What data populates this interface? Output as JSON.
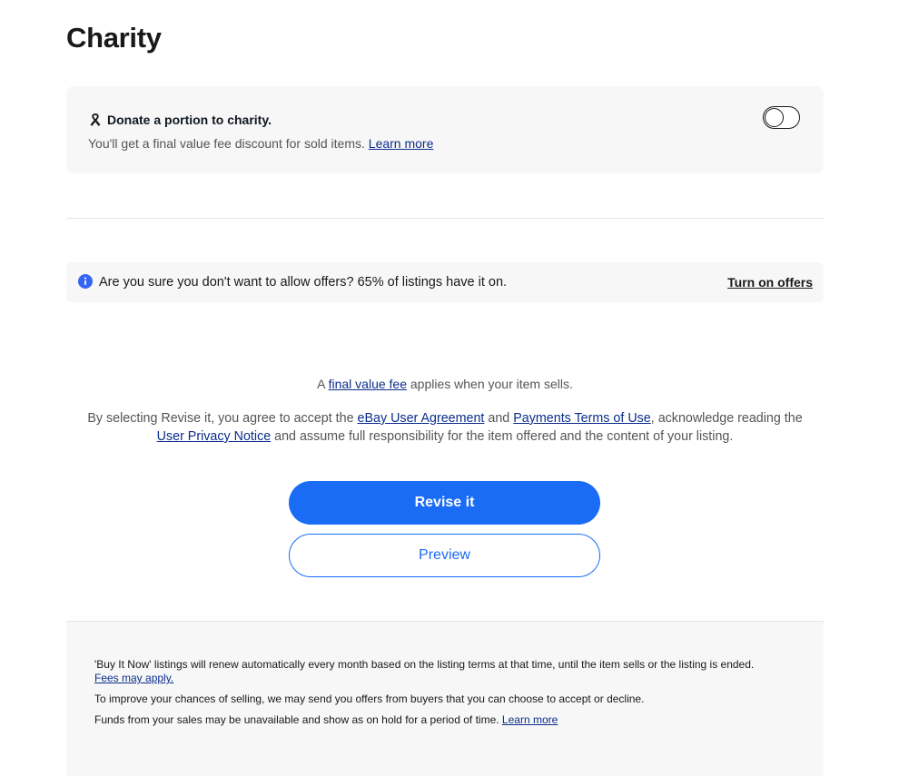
{
  "section_title": "Charity",
  "charity": {
    "heading": "Donate a portion to charity.",
    "description": "You'll get a final value fee discount for sold items.",
    "learn_more": "Learn more",
    "toggle_on": false
  },
  "offers_notice": {
    "message": "Are you sure you don't want to allow offers? 65% of listings have it on.",
    "action": "Turn on offers"
  },
  "fee_notice": {
    "prefix": "A",
    "link": "final value fee",
    "suffix": "applies when your item sells."
  },
  "agreement": {
    "part1": "By selecting Revise it, you agree to accept the",
    "link1": "eBay User Agreement",
    "part2": "and",
    "link2": "Payments Terms of Use",
    "part3": ", acknowledge reading the",
    "link3": "User Privacy Notice",
    "part4": "and assume full responsibility for the item offered and the content of your listing."
  },
  "buttons": {
    "primary": "Revise it",
    "secondary": "Preview"
  },
  "footer": {
    "line1": "'Buy It Now' listings will renew automatically every month based on the listing terms at that time, until the item sells or the listing is ended.",
    "line1_link": "Fees may apply.",
    "line2": "To improve your chances of selling, we may send you offers from buyers that you can choose to accept or decline.",
    "line3": "Funds from your sales may be unavailable and show as on hold for a period of time.",
    "line3_link": "Learn more"
  },
  "colors": {
    "primary_blue": "#1a6cf5",
    "link_blue": "#0b2e8c",
    "card_bg": "#f7f7f7",
    "info_blue": "#3665f3"
  },
  "icons": {
    "charity": "ribbon-icon",
    "info": "info-icon"
  }
}
